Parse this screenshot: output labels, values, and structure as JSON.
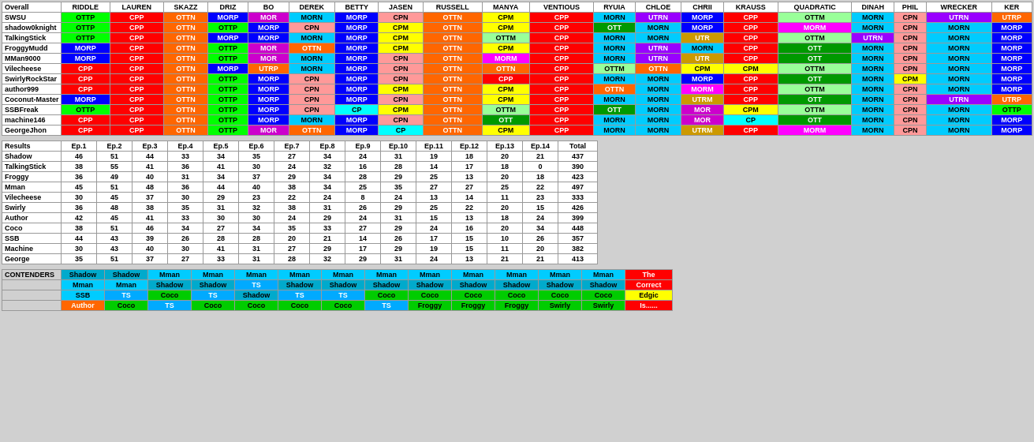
{
  "topTable": {
    "headers": [
      "Overall",
      "RIDDLE",
      "LAUREN",
      "SKAZZ",
      "DRIZ",
      "BO",
      "DEREK",
      "BETTY",
      "JASEN",
      "RUSSELL",
      "MANYA",
      "VENTIOUS",
      "RYUIA",
      "CHLOE",
      "CHRII",
      "KRAUSS",
      "QUADRATIC",
      "DINAH",
      "PHIL",
      "WRECKER",
      "KER"
    ],
    "rows": [
      {
        "label": "SWSU",
        "cells": [
          "OTTP",
          "CPP",
          "OTTN",
          "MORP",
          "MOR",
          "MORN",
          "MORP",
          "CPN",
          "OTTN",
          "CPM",
          "CPP",
          "MORN",
          "UTRN",
          "MORP",
          "CPP",
          "OTTM",
          "MORN",
          "CPN",
          "UTRN",
          "UTRP"
        ]
      },
      {
        "label": "shadow0knight",
        "cells": [
          "OTTP",
          "CPP",
          "OTTN",
          "OTTP",
          "MORP",
          "CPN",
          "MORP",
          "CPM",
          "OTTN",
          "CPM",
          "CPP",
          "OTT",
          "MORN",
          "MORP",
          "CPP",
          "MORM",
          "MORN",
          "CPN",
          "MORN",
          "MORP"
        ]
      },
      {
        "label": "TalkingStick",
        "cells": [
          "OTTP",
          "CPP",
          "OTTN",
          "MORP",
          "MORP",
          "MORN",
          "MORP",
          "CPM",
          "OTTN",
          "OTTM",
          "CPP",
          "MORN",
          "MORN",
          "UTR",
          "CPP",
          "OTTM",
          "UTRN",
          "CPN",
          "MORN",
          "MORP"
        ]
      },
      {
        "label": "FroggyMudd",
        "cells": [
          "MORP",
          "CPP",
          "OTTN",
          "OTTP",
          "MOR",
          "OTTN",
          "MORP",
          "CPM",
          "OTTN",
          "CPM",
          "CPP",
          "MORN",
          "UTRN",
          "MORN",
          "CPP",
          "OTT",
          "MORN",
          "CPN",
          "MORN",
          "MORP"
        ]
      },
      {
        "label": "MMan9000",
        "cells": [
          "MORP",
          "CPP",
          "OTTN",
          "OTTP",
          "MOR",
          "MORN",
          "MORP",
          "CPN",
          "OTTN",
          "MORM",
          "CPP",
          "MORN",
          "UTRN",
          "UTR",
          "CPP",
          "OTT",
          "MORN",
          "CPN",
          "MORN",
          "MORP"
        ]
      },
      {
        "label": "Vilecheese",
        "cells": [
          "CPP",
          "CPP",
          "OTTN",
          "MORP",
          "UTRP",
          "MORN",
          "MORP",
          "CPN",
          "OTTN",
          "OTTN",
          "CPP",
          "OTTM",
          "OTTN",
          "CPM",
          "CPM",
          "OTTM",
          "MORN",
          "CPN",
          "MORN",
          "MORP"
        ]
      },
      {
        "label": "SwirlyRockStar",
        "cells": [
          "CPP",
          "CPP",
          "OTTN",
          "OTTP",
          "MORP",
          "CPN",
          "MORP",
          "CPN",
          "OTTN",
          "CPP",
          "CPP",
          "MORN",
          "MORN",
          "MORP",
          "CPP",
          "OTT",
          "MORN",
          "CPM",
          "MORN",
          "MORP"
        ]
      },
      {
        "label": "author999",
        "cells": [
          "CPP",
          "CPP",
          "OTTN",
          "OTTP",
          "MORP",
          "CPN",
          "MORP",
          "CPM",
          "OTTN",
          "CPM",
          "CPP",
          "OTTN",
          "MORN",
          "MORM",
          "CPP",
          "OTTM",
          "MORN",
          "CPN",
          "MORN",
          "MORP"
        ]
      },
      {
        "label": "Coconut-Master",
        "cells": [
          "MORP",
          "CPP",
          "OTTN",
          "OTTP",
          "MORP",
          "CPN",
          "MORP",
          "CPN",
          "OTTN",
          "CPM",
          "CPP",
          "MORN",
          "MORN",
          "UTRM",
          "CPP",
          "OTT",
          "MORN",
          "CPN",
          "UTRN",
          "UTRP"
        ]
      },
      {
        "label": "SSBFreak",
        "cells": [
          "OTTP",
          "CPP",
          "OTTN",
          "OTTP",
          "MORP",
          "CPN",
          "CP",
          "CPM",
          "OTTN",
          "OTTM",
          "CPP",
          "OTT",
          "MORN",
          "MOR",
          "CPM",
          "OTTM",
          "MORN",
          "CPN",
          "MORN",
          "OTTP"
        ]
      },
      {
        "label": "machine146",
        "cells": [
          "CPP",
          "CPP",
          "OTTN",
          "OTTP",
          "MORP",
          "MORN",
          "MORP",
          "CPN",
          "OTTN",
          "OTT",
          "CPP",
          "MORN",
          "MORN",
          "MOR",
          "CP",
          "OTT",
          "MORN",
          "CPN",
          "MORN",
          "MORP"
        ]
      },
      {
        "label": "GeorgeJhon",
        "cells": [
          "CPP",
          "CPP",
          "OTTN",
          "OTTP",
          "MOR",
          "OTTN",
          "MORP",
          "CP",
          "OTTN",
          "CPM",
          "CPP",
          "MORN",
          "MORN",
          "UTRM",
          "CPP",
          "MORM",
          "MORN",
          "CPN",
          "MORN",
          "MORP"
        ]
      }
    ]
  },
  "resultsTable": {
    "headers": [
      "Results",
      "Ep.1",
      "Ep.2",
      "Ep.3",
      "Ep.4",
      "Ep.5",
      "Ep.6",
      "Ep.7",
      "Ep.8",
      "Ep.9",
      "Ep.10",
      "Ep.11",
      "Ep.12",
      "Ep.13",
      "Ep.14",
      "Total"
    ],
    "rows": [
      {
        "label": "Shadow",
        "vals": [
          46,
          51,
          44,
          33,
          34,
          35,
          27,
          34,
          24,
          31,
          19,
          18,
          20,
          21,
          437
        ]
      },
      {
        "label": "TalkingStick",
        "vals": [
          38,
          55,
          41,
          36,
          41,
          30,
          24,
          32,
          16,
          28,
          14,
          17,
          18,
          0,
          390
        ]
      },
      {
        "label": "Froggy",
        "vals": [
          36,
          49,
          40,
          31,
          34,
          37,
          29,
          34,
          28,
          29,
          25,
          13,
          20,
          18,
          423
        ]
      },
      {
        "label": "Mman",
        "vals": [
          45,
          51,
          48,
          36,
          44,
          40,
          38,
          34,
          25,
          35,
          27,
          27,
          25,
          22,
          497
        ]
      },
      {
        "label": "Vilecheese",
        "vals": [
          30,
          45,
          37,
          30,
          29,
          23,
          22,
          24,
          8,
          24,
          13,
          14,
          11,
          23,
          333
        ]
      },
      {
        "label": "Swirly",
        "vals": [
          36,
          48,
          38,
          35,
          31,
          32,
          38,
          31,
          26,
          29,
          25,
          22,
          20,
          15,
          426
        ]
      },
      {
        "label": "Author",
        "vals": [
          42,
          45,
          41,
          33,
          30,
          30,
          24,
          29,
          24,
          31,
          15,
          13,
          18,
          24,
          399
        ]
      },
      {
        "label": "Coco",
        "vals": [
          38,
          51,
          46,
          34,
          27,
          34,
          35,
          33,
          27,
          29,
          24,
          16,
          20,
          34,
          448
        ]
      },
      {
        "label": "SSB",
        "vals": [
          44,
          43,
          39,
          26,
          28,
          28,
          20,
          21,
          14,
          26,
          17,
          15,
          10,
          26,
          357
        ]
      },
      {
        "label": "Machine",
        "vals": [
          30,
          43,
          40,
          30,
          41,
          31,
          27,
          29,
          17,
          29,
          19,
          15,
          11,
          20,
          382
        ]
      },
      {
        "label": "George",
        "vals": [
          35,
          51,
          37,
          27,
          33,
          31,
          28,
          32,
          29,
          31,
          24,
          13,
          21,
          21,
          413
        ]
      }
    ]
  },
  "contenders": {
    "label": "CONTENDERS",
    "row1": [
      "Shadow",
      "Shadow",
      "Mman",
      "Mman",
      "Mman",
      "Mman",
      "Mman",
      "Mman",
      "Mman",
      "Mman",
      "Mman",
      "Mman",
      "Mman",
      "The"
    ],
    "row2": [
      "Mman",
      "Mman",
      "Shadow",
      "Shadow",
      "TS",
      "Shadow",
      "Shadow",
      "Shadow",
      "Shadow",
      "Shadow",
      "Shadow",
      "Shadow",
      "Shadow",
      "Correct"
    ],
    "row3": [
      "SSB",
      "TS",
      "Coco",
      "TS",
      "Shadow",
      "TS",
      "TS",
      "Coco",
      "Coco",
      "Coco",
      "Coco",
      "Coco",
      "Coco",
      "Edgic"
    ],
    "row4": [
      "Author",
      "Coco",
      "TS",
      "Coco",
      "Coco",
      "Coco",
      "Coco",
      "TS",
      "Froggy",
      "Froggy",
      "Froggy",
      "Swirly",
      "Swirly",
      "Is......"
    ]
  }
}
